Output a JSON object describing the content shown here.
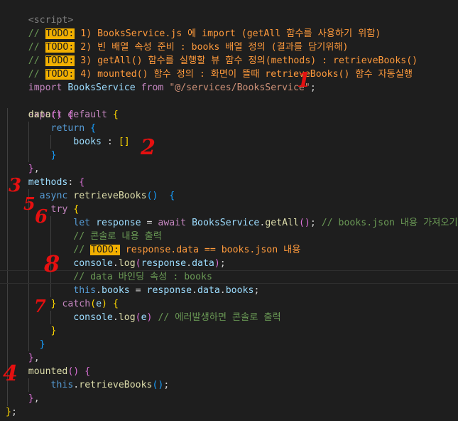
{
  "tag_line": "<script>",
  "todo_label": "TODO:",
  "todos": [
    "1) BooksService.js 에 import (getAll 함수를 사용하기 위함)",
    "2) 빈 배열 속성 준비 : books 배열 정의 (결과를 담기위해)",
    "3) getAll() 함수를 실행할 뷰 함수 정의(methods) : retrieveBooks()",
    "4) mounted() 함수 정의 : 화면이 뜰때 retrieveBooks() 함수 자동실행"
  ],
  "code": {
    "import_kw": "import",
    "service": "BooksService",
    "from_kw": "from",
    "path": "\"@/services/BooksService\"",
    "export_kw": "export",
    "default_kw": "default",
    "data_fn": "data",
    "return_kw": "return",
    "books": "books",
    "methods": "methods",
    "async_kw": "async",
    "retrieve": "retrieveBooks",
    "try_kw": "try",
    "let_kw": "let",
    "response": "response",
    "await_kw": "await",
    "getall": "getAll",
    "comment_fetch": "// books.json 내용 가져오기",
    "comment_console": "// 콘솔로 내용 출력",
    "todo_response": "response.data == books.json 내용",
    "console": "console",
    "log": "log",
    "data_prop": "data",
    "comment_binding": "// data 바인딩 속성 : books",
    "this_kw": "this",
    "catch_kw": "catch",
    "e": "e",
    "comment_error": "// 에러발생하면 콘솔로 출력",
    "mounted": "mounted"
  },
  "annotations": [
    "1",
    "2",
    "3",
    "5",
    "6",
    "7",
    "8",
    "4"
  ]
}
